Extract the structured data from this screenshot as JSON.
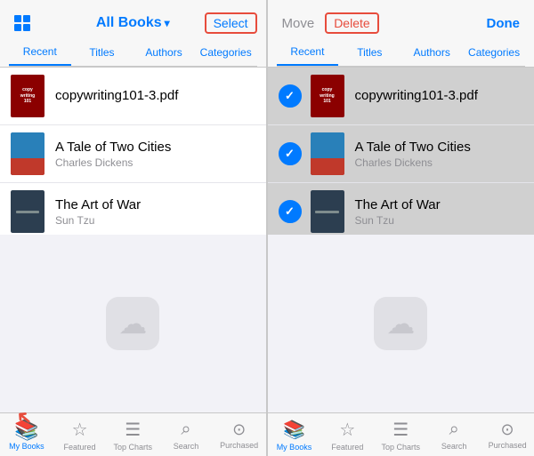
{
  "left_panel": {
    "header": {
      "title": "All Books",
      "title_chevron": "▾",
      "select_btn": "Select",
      "grid_btn": "grid"
    },
    "tabs": [
      {
        "label": "Recent",
        "active": true
      },
      {
        "label": "Titles",
        "active": false
      },
      {
        "label": "Authors",
        "active": false
      },
      {
        "label": "Categories",
        "active": false
      }
    ],
    "books": [
      {
        "title": "copywriting101-3.pdf",
        "author": "",
        "cover_type": "pdf"
      },
      {
        "title": "A Tale of Two Cities",
        "author": "Charles Dickens",
        "cover_type": "tale"
      },
      {
        "title": "The Art of War",
        "author": "Sun Tzu",
        "cover_type": "war"
      }
    ],
    "nav": [
      {
        "label": "My Books",
        "active": true,
        "icon": "📚"
      },
      {
        "label": "Featured",
        "active": false,
        "icon": "☆"
      },
      {
        "label": "Top Charts",
        "active": false,
        "icon": "☰"
      },
      {
        "label": "Search",
        "active": false,
        "icon": "⌕"
      },
      {
        "label": "Purchased",
        "active": false,
        "icon": "○"
      }
    ]
  },
  "right_panel": {
    "header": {
      "move_btn": "Move",
      "delete_btn": "Delete",
      "done_btn": "Done"
    },
    "tabs": [
      {
        "label": "Recent",
        "active": true
      },
      {
        "label": "Titles",
        "active": false
      },
      {
        "label": "Authors",
        "active": false
      },
      {
        "label": "Categories",
        "active": false
      }
    ],
    "books": [
      {
        "title": "copywriting101-3.pdf",
        "author": "",
        "cover_type": "pdf",
        "selected": true
      },
      {
        "title": "A Tale of Two Cities",
        "author": "Charles Dickens",
        "cover_type": "tale",
        "selected": true
      },
      {
        "title": "The Art of War",
        "author": "Sun Tzu",
        "cover_type": "war",
        "selected": true
      }
    ],
    "nav": [
      {
        "label": "My Books",
        "active": true,
        "icon": "📚"
      },
      {
        "label": "Featured",
        "active": false,
        "icon": "☆"
      },
      {
        "label": "Top Charts",
        "active": false,
        "icon": "☰"
      },
      {
        "label": "Search",
        "active": false,
        "icon": "⌕"
      },
      {
        "label": "Purchased",
        "active": false,
        "icon": "○"
      }
    ]
  },
  "icloud_placeholder": "☁"
}
